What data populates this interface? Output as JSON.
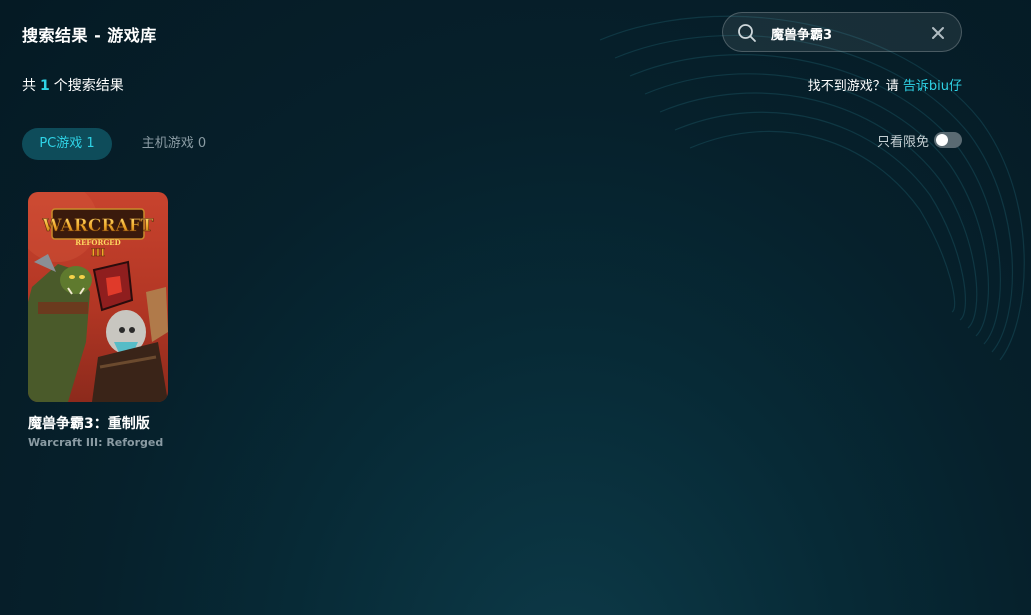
{
  "header": {
    "title": "搜索结果 - 游戏库"
  },
  "search": {
    "value": "魔兽争霸3",
    "search_icon": "search-icon",
    "clear_icon": "close-icon"
  },
  "results": {
    "prefix": "共",
    "count": "1",
    "suffix": "个搜索结果"
  },
  "feedback": {
    "text": "找不到游戏？请 ",
    "link": "告诉biu仔"
  },
  "tabs": [
    {
      "label": "PC游戏 1",
      "active": true
    },
    {
      "label": "主机游戏 0",
      "active": false
    }
  ],
  "filter": {
    "label": "只看限免",
    "enabled": false
  },
  "games": [
    {
      "title": "魔兽争霸3：重制版",
      "subtitle": "Warcraft III: Reforged",
      "cover_logo": "WARCRAFT",
      "cover_logo_sub": "REFORGED",
      "cover_numeral": "III"
    }
  ],
  "colors": {
    "accent": "#2fd3e6",
    "tab_active_bg": "#0e4c5a",
    "background": "#06202b",
    "muted_text": "#8a9ba3"
  }
}
